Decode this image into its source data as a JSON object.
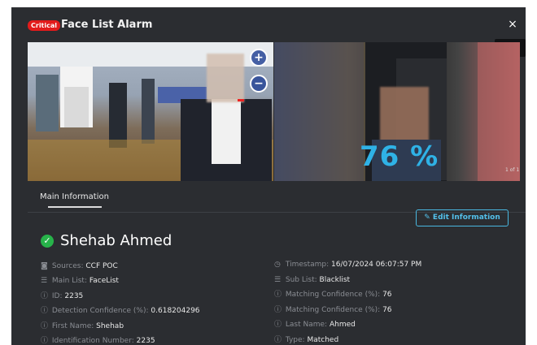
{
  "header": {
    "severity_badge": "Critical",
    "title": "Face List Alarm",
    "close_icon": "×",
    "close_tooltip": "Close"
  },
  "images": {
    "zoom_in": "+",
    "zoom_out": "−",
    "match_percent": "76 %",
    "pager": "1 of 1"
  },
  "tabs": [
    "Main Information"
  ],
  "edit_button": "Edit Information",
  "person": {
    "name": "Shehab Ahmed"
  },
  "left_fields": [
    {
      "icon": "camera-icon",
      "glyph": "◙",
      "label": "Sources:",
      "value": "CCF POC"
    },
    {
      "icon": "list-icon",
      "glyph": "☰",
      "label": "Main List:",
      "value": "FaceList"
    },
    {
      "icon": "info-icon",
      "glyph": "ⓘ",
      "label": "ID:",
      "value": "2235"
    },
    {
      "icon": "info-icon",
      "glyph": "ⓘ",
      "label": "Detection Confidence (%):",
      "value": "0.618204296"
    },
    {
      "icon": "info-icon",
      "glyph": "ⓘ",
      "label": "First Name:",
      "value": "Shehab"
    },
    {
      "icon": "info-icon",
      "glyph": "ⓘ",
      "label": "Identification Number:",
      "value": "2235"
    }
  ],
  "right_fields": [
    {
      "icon": "clock-icon",
      "glyph": "◷",
      "label": "Timestamp:",
      "value": "16/07/2024 06:07:57 PM"
    },
    {
      "icon": "list-icon",
      "glyph": "☰",
      "label": "Sub List:",
      "value": "Blacklist"
    },
    {
      "icon": "info-icon",
      "glyph": "ⓘ",
      "label": "Matching Confidence (%):",
      "value": "76"
    },
    {
      "icon": "info-icon",
      "glyph": "ⓘ",
      "label": "Matching Confidence (%):",
      "value": "76"
    },
    {
      "icon": "info-icon",
      "glyph": "ⓘ",
      "label": "Last Name:",
      "value": "Ahmed"
    },
    {
      "icon": "info-icon",
      "glyph": "ⓘ",
      "label": "Type:",
      "value": "Matched"
    }
  ],
  "colors": {
    "accent": "#49b7e0",
    "critical": "#e21b1b",
    "success": "#27b34a",
    "match_percent": "#2fb2e6"
  }
}
